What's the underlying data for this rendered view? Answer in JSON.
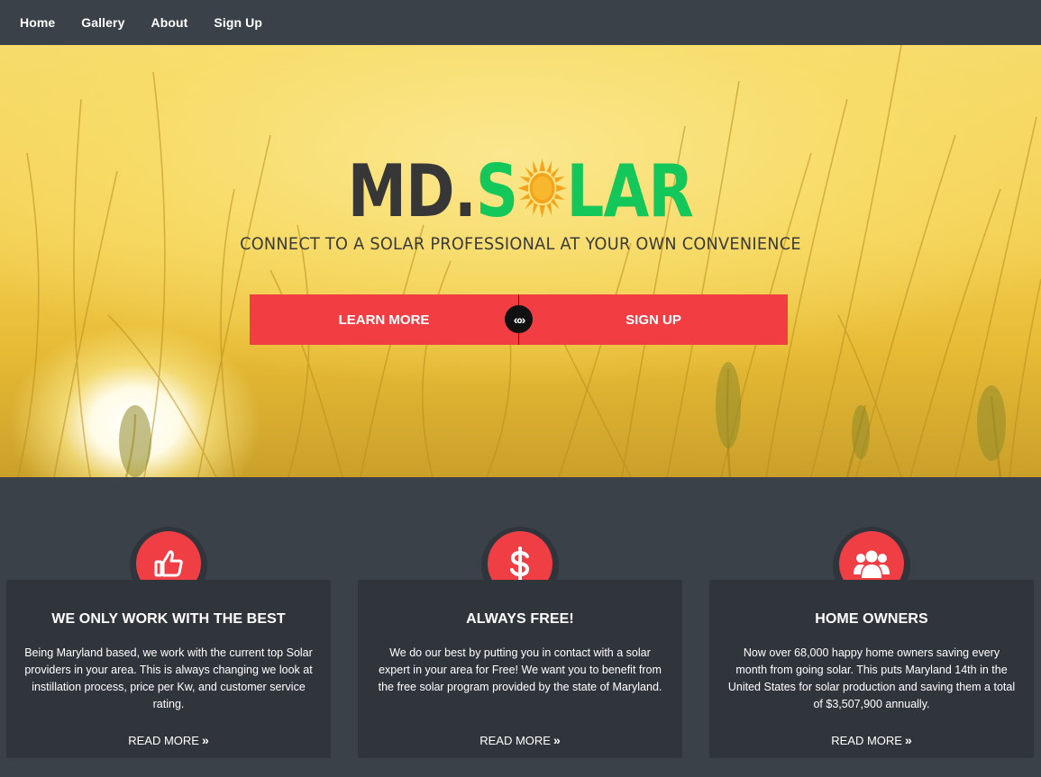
{
  "nav": {
    "items": [
      {
        "label": "Home"
      },
      {
        "label": "Gallery"
      },
      {
        "label": "About"
      },
      {
        "label": "Sign Up"
      }
    ]
  },
  "hero": {
    "logo_md": "MD.",
    "logo_s": "S",
    "logo_lar": "LAR",
    "tagline": "CONNECT TO A SOLAR PROFESSIONAL AT YOUR OWN CONVENIENCE",
    "learn_more_label": "LEARN MORE",
    "sign_up_label": "SIGN UP",
    "swap_glyph": "«»"
  },
  "features": [
    {
      "icon": "thumbs-up-icon",
      "title": "WE ONLY WORK WITH THE BEST",
      "body": "Being Maryland based, we work with the current top Solar providers in your area. This is always changing we look at instillation process, price per Kw, and customer service rating.",
      "link": "READ MORE"
    },
    {
      "icon": "dollar-icon",
      "title": "ALWAYS FREE!",
      "body": "We do our best by putting you in contact with a solar expert in your area for Free! We want you to benefit from the free solar program provided by the state of Maryland.",
      "link": "READ MORE"
    },
    {
      "icon": "users-icon",
      "title": "HOME OWNERS",
      "body": "Now over 68,000 happy home owners saving every month from going solar. This puts Maryland 14th in the United States for solar production and saving them a total of $3,507,900 annually.",
      "link": "READ MORE"
    }
  ],
  "colors": {
    "nav_bg": "#3b4149",
    "accent_red": "#f23d43",
    "logo_green": "#13c75a",
    "logo_dark": "#373737",
    "card_bg": "#30353c",
    "sun_orange": "#f4a41c"
  }
}
